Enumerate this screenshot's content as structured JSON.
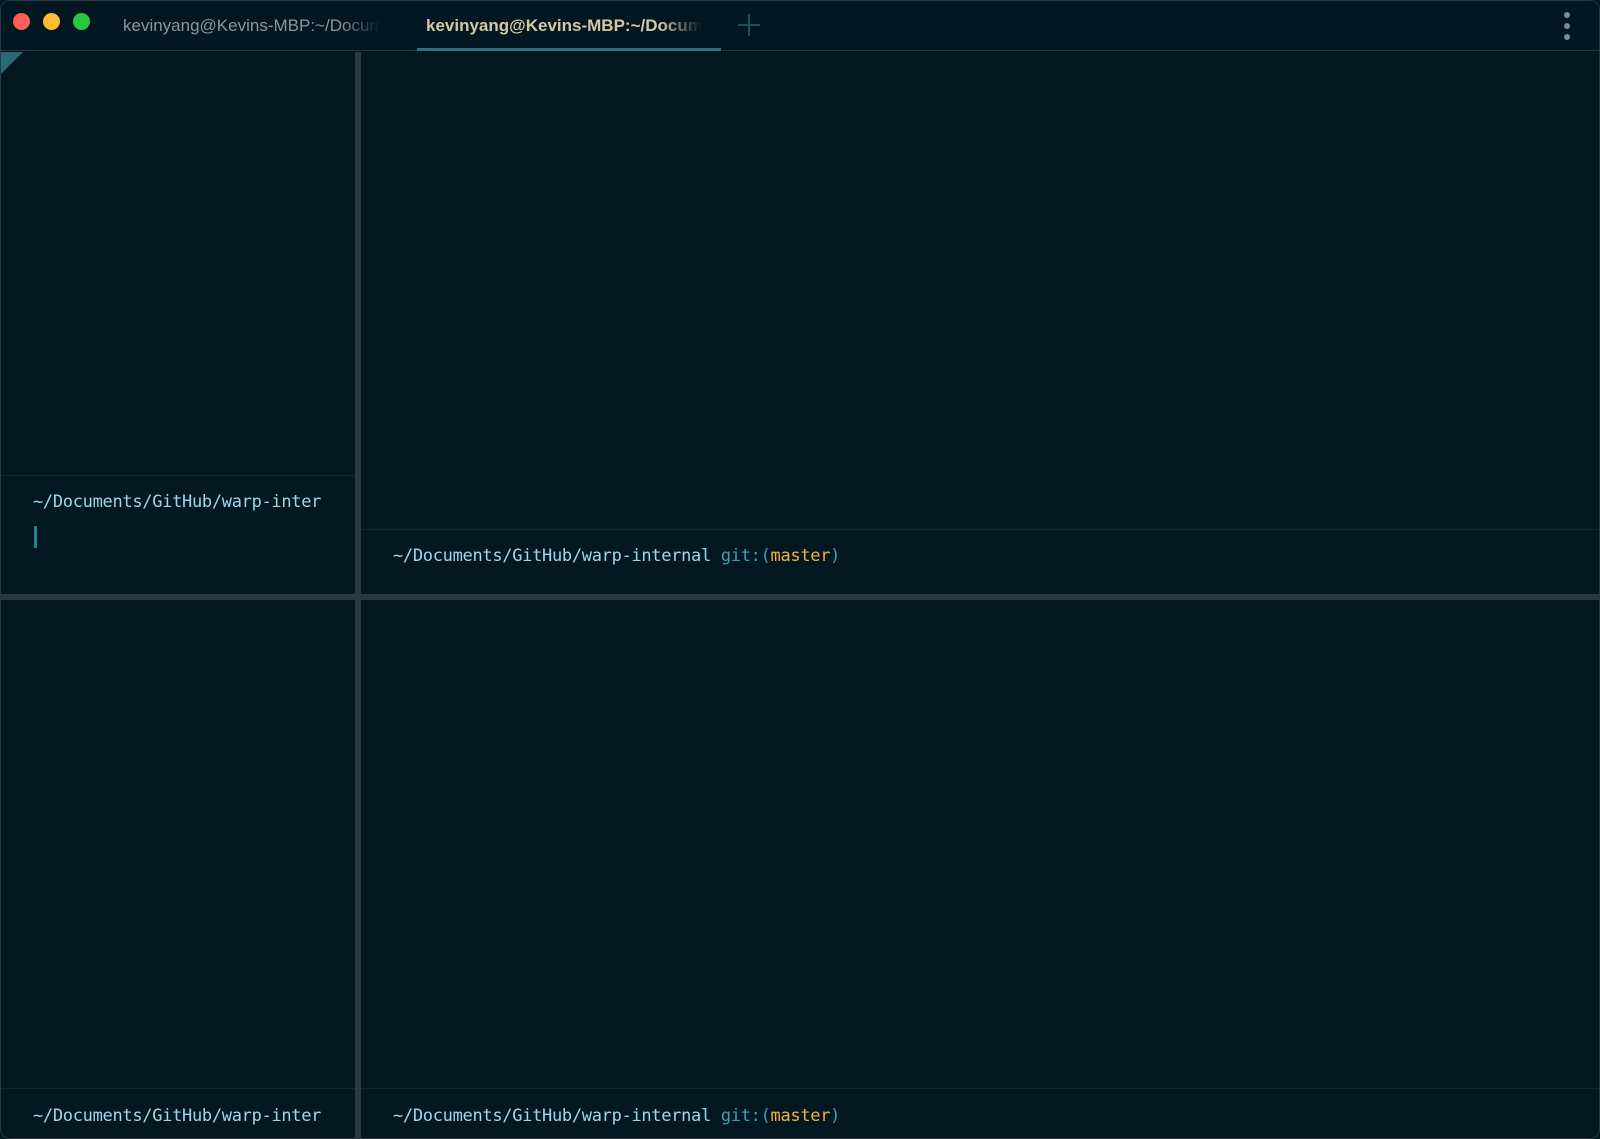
{
  "window": {
    "tabs": [
      {
        "label": "kevinyang@Kevins-MBP:~/Documents/GitHub/warp-internal",
        "active": false
      },
      {
        "label": "kevinyang@Kevins-MBP:~/Documents/GitHub/warp-internal",
        "active": true
      }
    ],
    "new_tab_icon": "plus-icon",
    "menu_icon": "vertical-ellipsis-icon"
  },
  "panes": {
    "top_left": {
      "prompt_path": "~/Documents/GitHub/warp-inter",
      "active": true
    },
    "top_right": {
      "prompt_path": "~/Documents/GitHub/warp-internal",
      "git_label": "git:",
      "paren_open": "(",
      "branch": "master",
      "paren_close": ")"
    },
    "bottom_left": {
      "prompt_path": "~/Documents/GitHub/warp-inter"
    },
    "bottom_right": {
      "prompt_path": "~/Documents/GitHub/warp-internal",
      "git_label": "git:",
      "paren_open": "(",
      "branch": "master",
      "paren_close": ")"
    }
  },
  "colors": {
    "background": "#041821",
    "path": "#9fd7ea",
    "git": "#3aa0b8",
    "branch": "#f2b23b",
    "active_tab_text": "#d6c7a3",
    "active_tab_underline": "#2f6f79"
  }
}
